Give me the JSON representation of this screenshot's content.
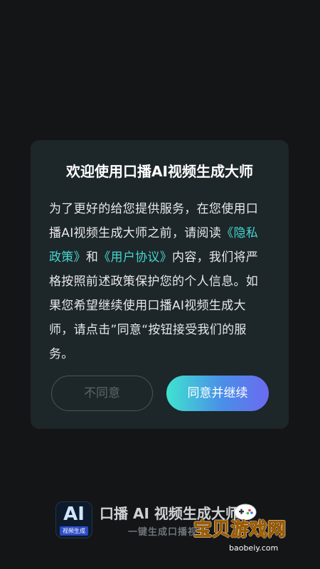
{
  "dialog": {
    "title": "欢迎使用口播AI视频生成大师",
    "body_part1": "为了更好的给您提供服务，在您使用口播AI视频生成大师之前，请阅读",
    "privacy_link": "《隐私政策》",
    "and_text": "和",
    "user_agreement_link": "《用户协议》",
    "body_part2": "内容，我们将严格按照前述政策保护您的个人信息。如果您希望继续使用口播AI视频生成大师，请点击”同意“按钮接受我们的服务。",
    "decline_label": "不同意",
    "agree_label": "同意并继续"
  },
  "footer": {
    "icon_text": "AI",
    "icon_subtext": "视频生成",
    "app_name": "口播 AI 视频生成大师",
    "slogan": "一键生成口播视频"
  },
  "watermark": {
    "text": "宝贝游戏网",
    "domain": "baobeiy.com"
  },
  "colors": {
    "background": "#141516",
    "dialog": "#1d2629",
    "link": "#45d6cf",
    "agree_gradient_start": "#3fe3cf",
    "agree_gradient_end": "#6b6af0"
  }
}
